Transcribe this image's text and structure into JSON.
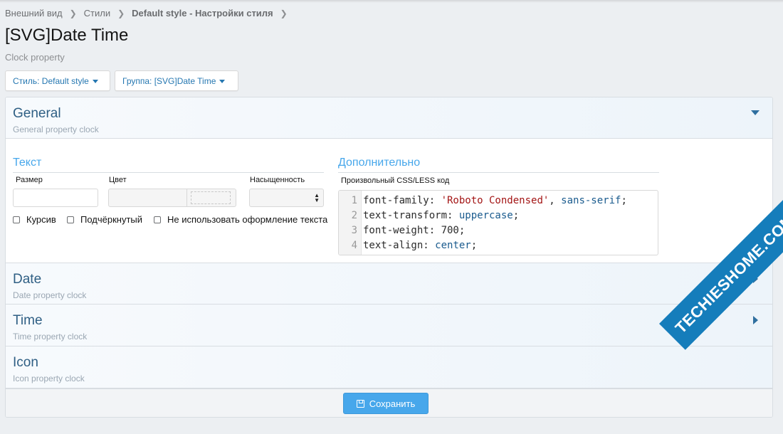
{
  "breadcrumb": {
    "items": [
      "Внешний вид",
      "Стили"
    ],
    "current": "Default style - Настройки стиля"
  },
  "page": {
    "title": "[SVG]Date Time",
    "description": "Clock property"
  },
  "filters": {
    "style_label": "Стиль: Default style",
    "group_label": "Группа: [SVG]Date Time"
  },
  "groups": [
    {
      "title": "General",
      "description": "General property clock",
      "expanded": true
    },
    {
      "title": "Date",
      "description": "Date property clock",
      "expanded": false
    },
    {
      "title": "Time",
      "description": "Time property clock",
      "expanded": false
    },
    {
      "title": "Icon",
      "description": "Icon property clock",
      "expanded": false
    }
  ],
  "text_section": {
    "title": "Текст",
    "size_label": "Размер",
    "color_label": "Цвет",
    "weight_label": "Насыщенность",
    "checkboxes": [
      "Курсив",
      "Подчёркнутый",
      "Не использовать оформление текста"
    ]
  },
  "extra_section": {
    "title": "Дополнительно",
    "css_label": "Произвольный CSS/LESS код",
    "code_lines": [
      {
        "num": "1",
        "prop": "font-family: ",
        "parts": [
          {
            "t": "'Roboto Condensed'",
            "c": "str"
          },
          {
            "t": ", ",
            "c": "prop"
          },
          {
            "t": "sans-serif",
            "c": "val"
          },
          {
            "t": ";",
            "c": "prop"
          }
        ]
      },
      {
        "num": "2",
        "prop": "text-transform: ",
        "parts": [
          {
            "t": "uppercase",
            "c": "val"
          },
          {
            "t": ";",
            "c": "prop"
          }
        ]
      },
      {
        "num": "3",
        "prop": "font-weight: ",
        "parts": [
          {
            "t": "700",
            "c": "prop"
          },
          {
            "t": ";",
            "c": "prop"
          }
        ]
      },
      {
        "num": "4",
        "prop": "text-align: ",
        "parts": [
          {
            "t": "center",
            "c": "val"
          },
          {
            "t": ";",
            "c": "prop"
          }
        ]
      }
    ]
  },
  "save_label": "Сохранить",
  "watermark": "TECHIESHOME.COM",
  "colors": {
    "accent": "#47a7eb",
    "heading": "#2f5f84",
    "link": "#2577b1",
    "watermark": "#157dbb"
  },
  "icons": {
    "breadcrumb_separator": "chevron-right-icon",
    "dropdown": "caret-down-icon",
    "expand": "triangle-down-icon",
    "collapse": "triangle-right-icon",
    "save": "floppy-disk-icon",
    "select": "updown-arrows-icon"
  }
}
